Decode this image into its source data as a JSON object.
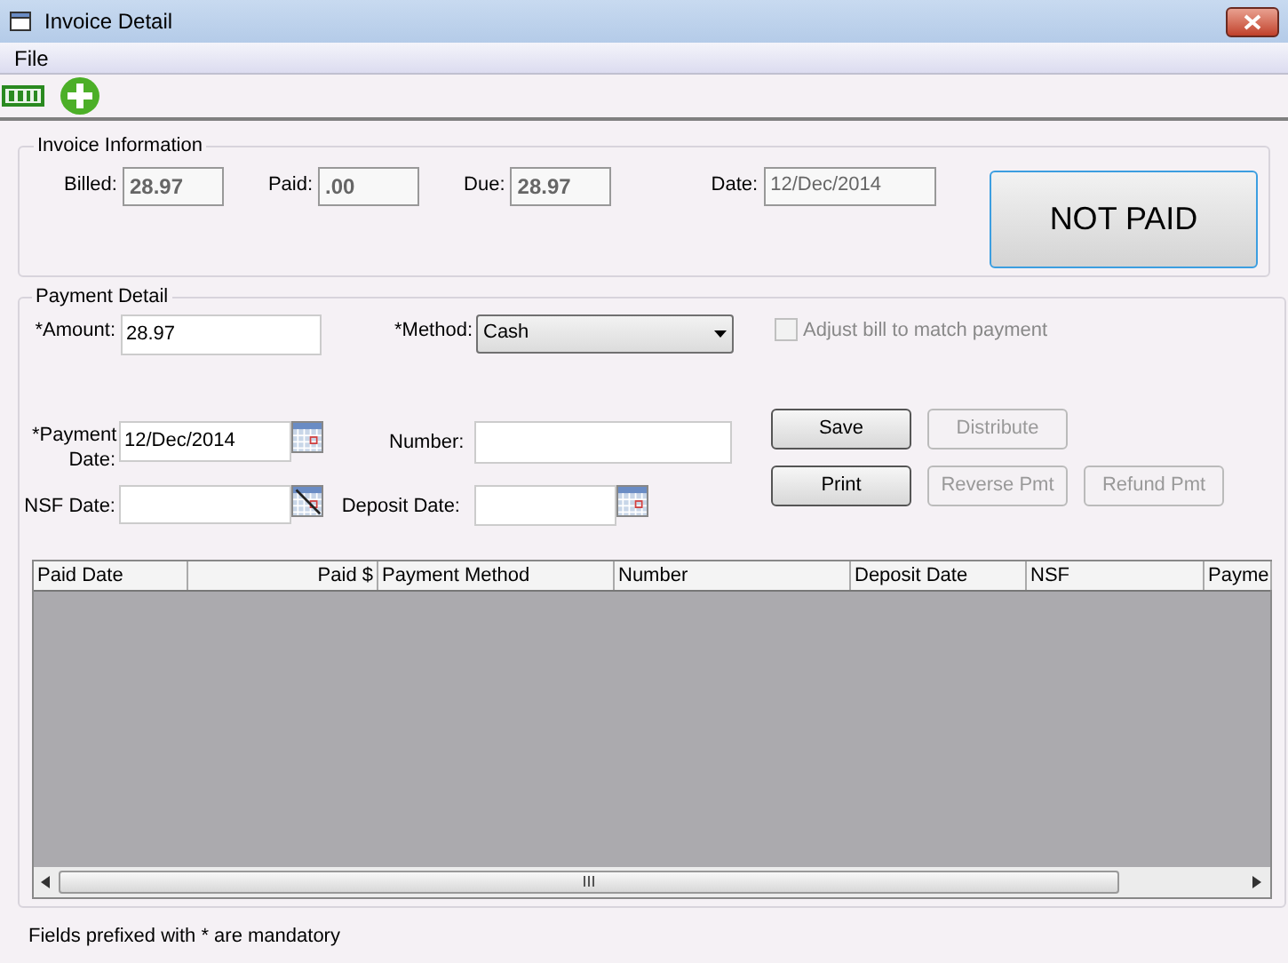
{
  "window": {
    "title": "Invoice Detail"
  },
  "menu": [
    "File"
  ],
  "invoice_information": {
    "title": "Invoice Information",
    "fields": [
      {
        "label": "Billed:",
        "value": "28.97",
        "bold": true
      },
      {
        "label": "Paid:",
        "value": ".00",
        "bold": true
      },
      {
        "label": "Due:",
        "value": "28.97",
        "bold": true
      },
      {
        "label": "Date:",
        "value": "12/Dec/2014",
        "bold": false
      }
    ],
    "status_button": "NOT PAID"
  },
  "payment_detail": {
    "title": "Payment Detail",
    "amount": {
      "label": "*Amount:",
      "value": "28.97"
    },
    "method": {
      "label": "*Method:",
      "value": "Cash"
    },
    "adjust_checkbox": {
      "label": "Adjust bill to match payment",
      "checked": false,
      "disabled": true
    },
    "payment_date": {
      "label_lines": [
        "*Payment",
        "Date:"
      ],
      "value": "12/Dec/2014"
    },
    "number": {
      "label": "Number:"
    },
    "nsf_date": {
      "label": "NSF Date:"
    },
    "deposit_date": {
      "label": "Deposit Date:"
    },
    "buttons": [
      {
        "label": "Save",
        "disabled": false
      },
      {
        "label": "Distribute",
        "disabled": true
      },
      {
        "label": "Print",
        "disabled": false
      },
      {
        "label": "Reverse Pmt",
        "disabled": true
      },
      {
        "label": "Refund Pmt",
        "disabled": true
      }
    ]
  },
  "table": {
    "columns": [
      {
        "label": "Paid Date",
        "kind": "text"
      },
      {
        "label": "Paid $",
        "kind": "amount"
      },
      {
        "label": "Payment Method",
        "kind": "text"
      },
      {
        "label": "Number",
        "kind": "text"
      },
      {
        "label": "Deposit Date",
        "kind": "text"
      },
      {
        "label": "NSF",
        "kind": "text"
      },
      {
        "label": "Payme",
        "kind": "text"
      }
    ]
  },
  "footer": "Fields prefixed with * are mandatory"
}
